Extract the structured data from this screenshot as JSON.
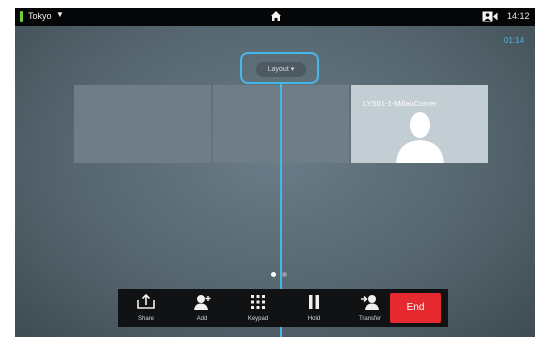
{
  "status_bar": {
    "location": "Tokyo",
    "clock": "14:12"
  },
  "call": {
    "timer": "01:14"
  },
  "layout_button": {
    "label": "Layout"
  },
  "participants": [
    {
      "name": ""
    },
    {
      "name": ""
    },
    {
      "name": "LYS01-1-MillauCorner"
    }
  ],
  "pager": {
    "pages": 2,
    "current": 1
  },
  "toolbar": {
    "share_label": "Share",
    "add_label": "Add",
    "keypad_label": "Keypad",
    "hold_label": "Hold",
    "transfer_label": "Transfer",
    "end_label": "End"
  },
  "colors": {
    "accent": "#45b8ea",
    "end": "#e42a2e",
    "signal": "#6fcf3a",
    "toolbar_bg": "#101214"
  }
}
